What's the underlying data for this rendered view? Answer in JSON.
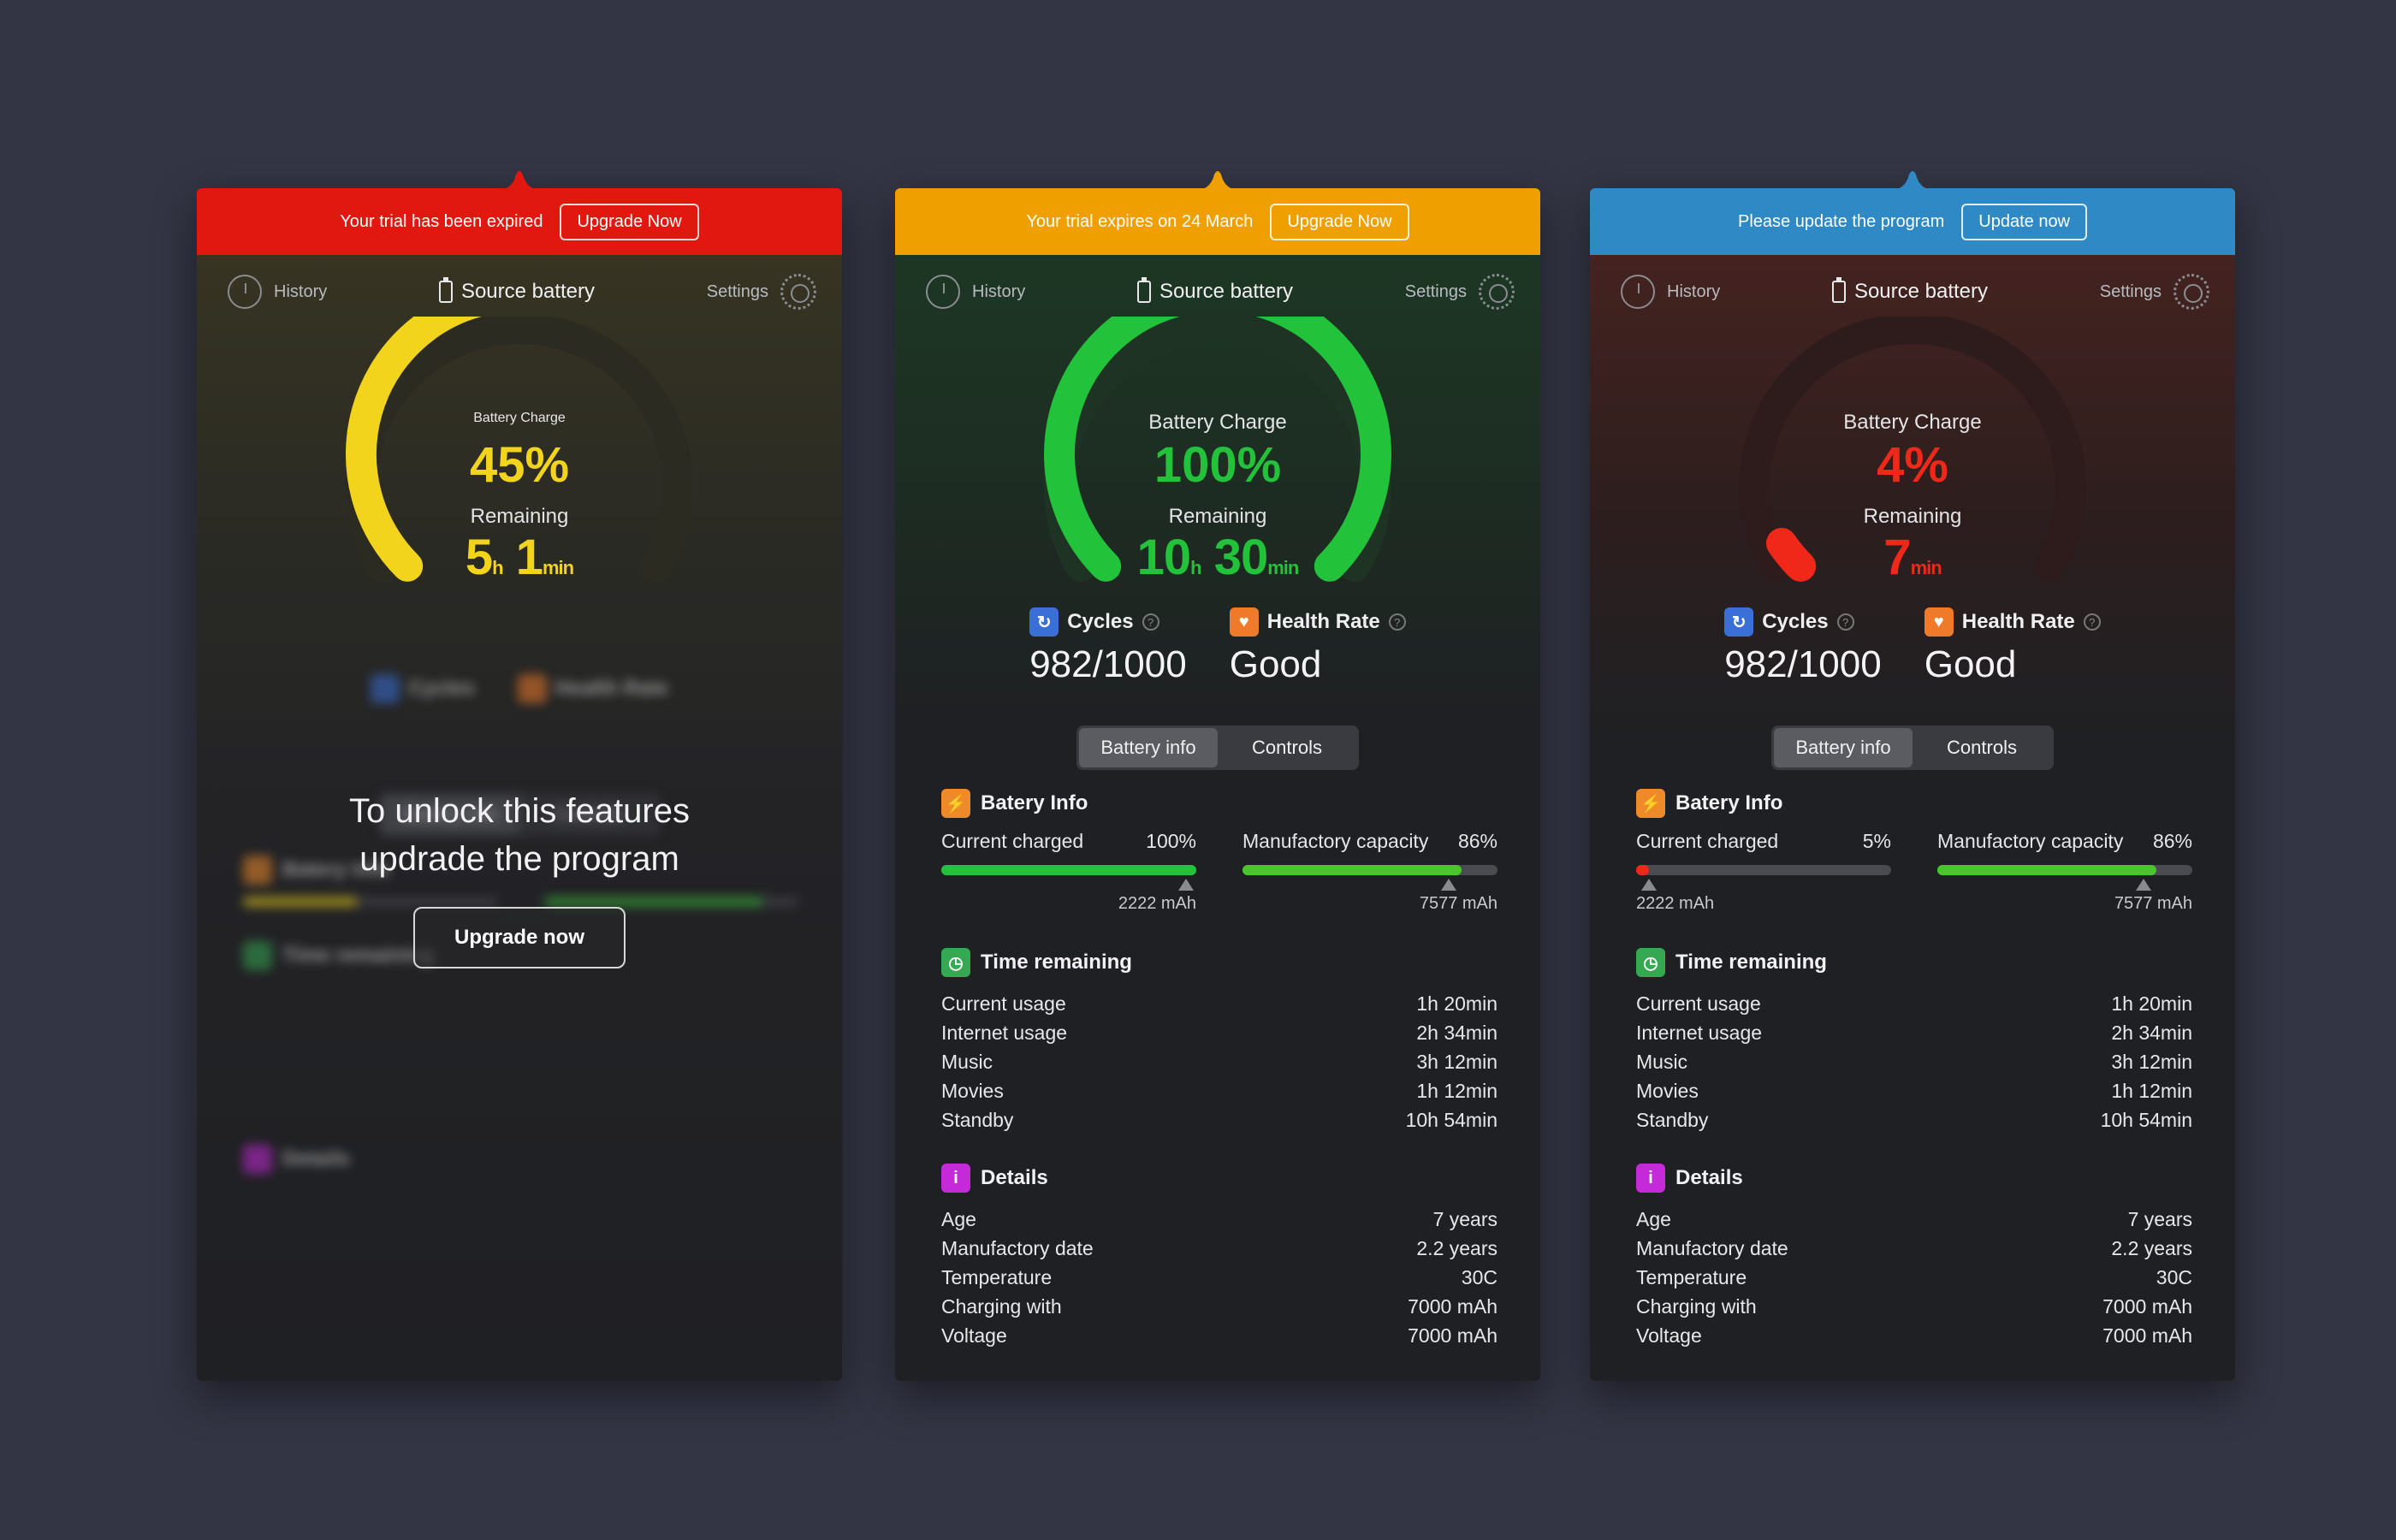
{
  "colors": {
    "background": "#333544",
    "red": "#e0180f",
    "orange": "#efa000",
    "blue": "#2f89c5",
    "yellow": "#f2d41c",
    "green": "#22c23a",
    "lowred": "#f0281a"
  },
  "common": {
    "history_label": "History",
    "source_label": "Source battery",
    "settings_label": "Settings",
    "charge_label": "Battery Charge",
    "remaining_label": "Remaining",
    "cycles_label": "Cycles",
    "health_label": "Health Rate",
    "help_icon": "?",
    "tab_info": "Battery info",
    "tab_controls": "Controls",
    "section_info": "Batery Info",
    "section_time": "Time remaining",
    "section_details": "Details",
    "current_charged_label": "Current charged",
    "manufactory_label": "Manufactory capacity",
    "unit_h": "h",
    "unit_min": "min"
  },
  "panels": [
    {
      "banner_text": "Your trial has been expired",
      "banner_button": "Upgrade Now",
      "charge": "45%",
      "charge_fraction": 0.45,
      "hours": "5",
      "minutes": "1",
      "lock_line1": "To unlock this features",
      "lock_line2": "updrade the program",
      "lock_button": "Upgrade now"
    },
    {
      "banner_text": "Your trial expires on 24 March",
      "banner_button": "Upgrade Now",
      "charge": "100%",
      "charge_fraction": 1.0,
      "hours": "10",
      "minutes": "30",
      "cycles": "982/1000",
      "health": "Good",
      "current_charged": "100%",
      "current_charged_fraction": 1.0,
      "current_mah": "2222 mAh",
      "manufactory_capacity": "86%",
      "manufactory_fraction": 0.86,
      "manufactory_mah": "7577 mAh",
      "time": [
        {
          "label": "Current usage",
          "value": "1h 20min"
        },
        {
          "label": "Internet usage",
          "value": "2h 34min"
        },
        {
          "label": "Music",
          "value": "3h 12min"
        },
        {
          "label": "Movies",
          "value": "1h 12min"
        },
        {
          "label": "Standby",
          "value": "10h 54min"
        }
      ],
      "details": [
        {
          "label": "Age",
          "value": "7 years"
        },
        {
          "label": "Manufactory date",
          "value": "2.2 years"
        },
        {
          "label": "Temperature",
          "value": "30C"
        },
        {
          "label": "Charging with",
          "value": "7000 mAh"
        },
        {
          "label": "Voltage",
          "value": "7000 mAh"
        }
      ]
    },
    {
      "banner_text": "Please update the program",
      "banner_button": "Update now",
      "charge": "4%",
      "charge_fraction": 0.04,
      "minutes": "7",
      "cycles": "982/1000",
      "health": "Good",
      "current_charged": "5%",
      "current_charged_fraction": 0.05,
      "current_mah": "2222 mAh",
      "manufactory_capacity": "86%",
      "manufactory_fraction": 0.86,
      "manufactory_mah": "7577 mAh",
      "time": [
        {
          "label": "Current usage",
          "value": "1h 20min"
        },
        {
          "label": "Internet usage",
          "value": "2h 34min"
        },
        {
          "label": "Music",
          "value": "3h 12min"
        },
        {
          "label": "Movies",
          "value": "1h 12min"
        },
        {
          "label": "Standby",
          "value": "10h 54min"
        }
      ],
      "details": [
        {
          "label": "Age",
          "value": "7 years"
        },
        {
          "label": "Manufactory date",
          "value": "2.2 years"
        },
        {
          "label": "Temperature",
          "value": "30C"
        },
        {
          "label": "Charging with",
          "value": "7000 mAh"
        },
        {
          "label": "Voltage",
          "value": "7000 mAh"
        }
      ]
    }
  ]
}
